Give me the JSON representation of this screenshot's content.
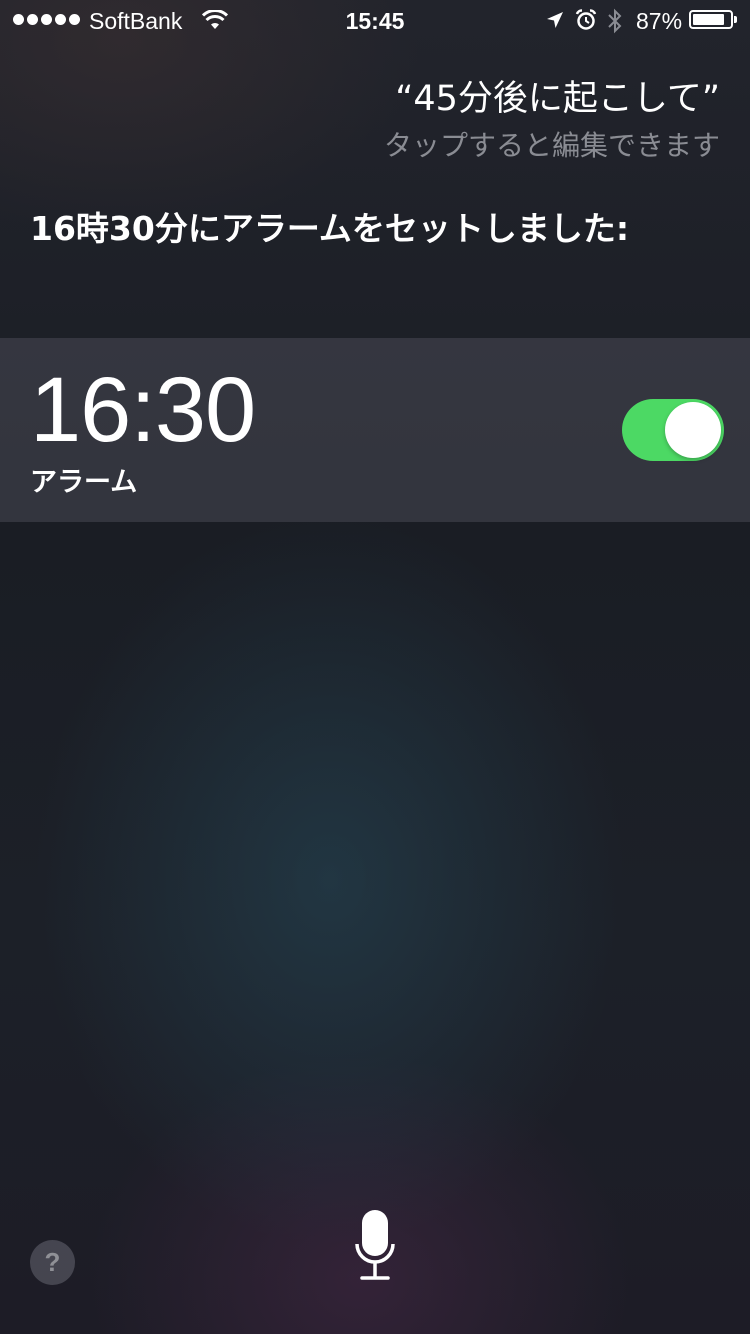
{
  "status_bar": {
    "signal_dots": 5,
    "carrier": "SoftBank",
    "time": "15:45",
    "battery_percent": "87%",
    "battery_level": 0.87,
    "icons": [
      "wifi-icon",
      "location-arrow-icon",
      "alarm-clock-icon",
      "bluetooth-icon",
      "battery-icon"
    ]
  },
  "siri": {
    "query": "“45分後に起こして”",
    "edit_hint": "タップすると編集できます",
    "response": "16時30分にアラームをセットしました:"
  },
  "alarm": {
    "time": "16:30",
    "label": "アラーム",
    "enabled": true,
    "toggle_color": "#4cd964"
  },
  "bottom": {
    "help_label": "?",
    "mic_icon": "microphone-icon"
  }
}
